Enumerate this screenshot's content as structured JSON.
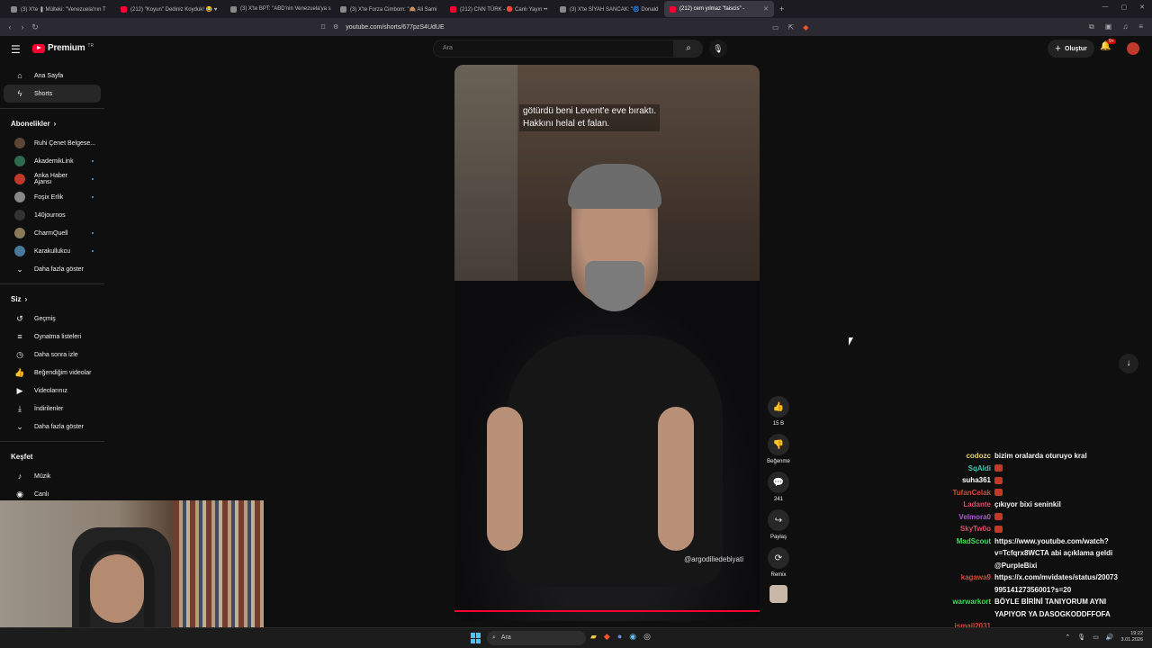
{
  "browser": {
    "tabs": [
      {
        "label": "(3) X'te ❚ Mülteki: \"Venezuela'nın T",
        "color": "#888888",
        "active": false
      },
      {
        "label": "(212) \"Koyun\" Dediniz Koyduk! 😂 ♥",
        "color": "#ff0033",
        "active": false
      },
      {
        "label": "(3) X'te BPT: \"ABD'nin Venezuela'ya s",
        "color": "#888888",
        "active": false
      },
      {
        "label": "(3) X'te Forza Cimbom: \"🙈 Ali Sami",
        "color": "#888888",
        "active": false
      },
      {
        "label": "(212) CNN TÜRK - 🔴 Canlı Yayın ••",
        "color": "#ff0033",
        "active": false
      },
      {
        "label": "(3) X'te SİYAH SANCAK: \"🌀 Donald",
        "color": "#888888",
        "active": false
      },
      {
        "label": "(212) cem yılmaz \"faiscis\" - ",
        "color": "#ff0033",
        "active": true
      }
    ],
    "url": "youtube.com/shorts/677pzS4UdUE"
  },
  "header": {
    "logo": "Premium",
    "logo_tr": "TR",
    "search_placeholder": "Ara",
    "create_label": "Oluştur",
    "notif_badge": "9+"
  },
  "sidebar": {
    "main": [
      {
        "label": "Ana Sayfa",
        "icon": "home-icon"
      },
      {
        "label": "Shorts",
        "icon": "shorts-icon",
        "active": true
      }
    ],
    "subs_title": "Abonelikler",
    "subs": [
      {
        "label": "Ruhi Çenet Belgese...",
        "color": "#5b4636",
        "dot": false
      },
      {
        "label": "AkademikLink",
        "color": "#2d6a4f",
        "dot": true
      },
      {
        "label": "Anka Haber Ajansı",
        "color": "#c0392b",
        "dot": true
      },
      {
        "label": "Foşix Erlik",
        "color": "#888888",
        "dot": true
      },
      {
        "label": "140journos",
        "color": "#333333",
        "dot": false
      },
      {
        "label": "CharmQuell",
        "color": "#8a7a5a",
        "dot": true
      },
      {
        "label": "Karakullukcu",
        "color": "#4a7a9a",
        "dot": true
      }
    ],
    "subs_more": "Daha fazla göster",
    "you_title": "Siz",
    "you": [
      {
        "label": "Geçmiş",
        "icon": "history-icon"
      },
      {
        "label": "Oynatma listeleri",
        "icon": "playlist-icon"
      },
      {
        "label": "Daha sonra izle",
        "icon": "clock-icon"
      },
      {
        "label": "Beğendiğim videolar",
        "icon": "like-icon"
      },
      {
        "label": "Videolarınız",
        "icon": "video-icon"
      },
      {
        "label": "İndirilenler",
        "icon": "download-icon"
      },
      {
        "label": "Daha fazla göster",
        "icon": "chevron-down-icon"
      }
    ],
    "explore_title": "Keşfet",
    "explore": [
      {
        "label": "Müzik",
        "icon": "music-icon"
      },
      {
        "label": "Canlı",
        "icon": "live-icon"
      }
    ]
  },
  "short": {
    "subtitle_line1": "götürdü beni Levent'e eve bıraktı.",
    "subtitle_line2": "Hakkını helal et falan.",
    "watermark": "@argodiliedebiyati"
  },
  "actions": {
    "like_count": "15 B",
    "dislike_label": "Beğenme",
    "comment_count": "241",
    "share_label": "Paylaş",
    "remix_label": "Remix"
  },
  "chat": [
    {
      "user": "codozc",
      "color": "#e8d37a",
      "msg": "bizim oralarda oturuyo kral",
      "emote": false
    },
    {
      "user": "SqAldi",
      "color": "#3cc7b0",
      "msg": "",
      "emote": true
    },
    {
      "user": "suha361",
      "color": "#ffffff",
      "msg": "",
      "emote": true
    },
    {
      "user": "TufanCelak",
      "color": "#d14a3a",
      "msg": "",
      "emote": true
    },
    {
      "user": "Ladante",
      "color": "#e04a6a",
      "msg": "çıkıyor bixi seninkil",
      "emote": false
    },
    {
      "user": "Velmora0",
      "color": "#b05ad8",
      "msg": "",
      "emote": true
    },
    {
      "user": "SkyTw0o",
      "color": "#e04a6a",
      "msg": "",
      "emote": true
    },
    {
      "user": "MadScout",
      "color": "#3ddc5a",
      "msg": "https://www.youtube.com/watch?",
      "emote": false
    },
    {
      "user": "",
      "color": "#ffffff",
      "msg": "v=Tcfqrx8WCTA abi açıklama geldi",
      "emote": false
    },
    {
      "user": "",
      "color": "#ffffff",
      "msg": "@PurpleBixi",
      "emote": false
    },
    {
      "user": "kagawa9",
      "color": "#d14a3a",
      "msg": "https://x.com/mvidates/status/20073",
      "emote": false
    },
    {
      "user": "",
      "color": "#ffffff",
      "msg": "99514127356001?s=20",
      "emote": false
    },
    {
      "user": "warwarkort",
      "color": "#3ddc5a",
      "msg": "BÖYLE BİRİNİ TANIYORUM AYNI",
      "emote": false
    },
    {
      "user": "",
      "color": "#ffffff",
      "msg": "YAPIYOR YA DASOGKODDFFOFA",
      "emote": false
    },
    {
      "user": "ismail2031",
      "color": "#d14a3a",
      "msg": "",
      "emote": false
    }
  ],
  "taskbar": {
    "search_label": "Ara",
    "time": "19:22",
    "date": "3.01.2026"
  }
}
